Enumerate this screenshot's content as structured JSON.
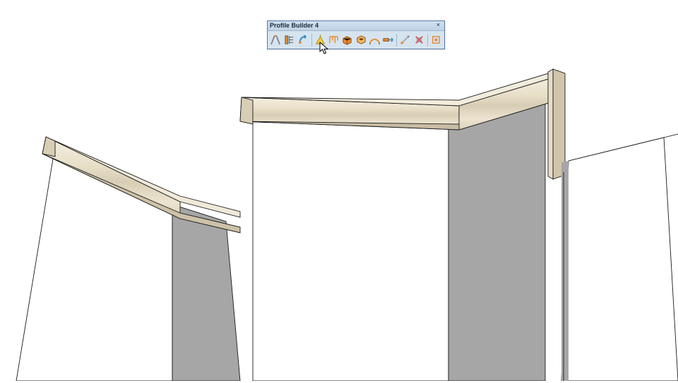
{
  "toolbar": {
    "title": "Profile Builder 4",
    "close": "×",
    "buttons": [
      {
        "name": "profile-builder-icon",
        "title": "Profile Builder"
      },
      {
        "name": "build-profile-icon",
        "title": "Build"
      },
      {
        "name": "revolve-icon",
        "title": "Build Along Path"
      },
      {
        "name": "trim-icon",
        "title": "Trim"
      },
      {
        "name": "smart-path-icon",
        "title": "Smart Path Select"
      },
      {
        "name": "assembly-icon",
        "title": "Assembler"
      },
      {
        "name": "hole-icon",
        "title": "Hole Tool"
      },
      {
        "name": "span-icon",
        "title": "Span Tool"
      },
      {
        "name": "extend-icon",
        "title": "Extend"
      },
      {
        "name": "slice-icon",
        "title": "Slice"
      },
      {
        "name": "remove-icon",
        "title": "Remove Holes"
      },
      {
        "name": "quantify-icon",
        "title": "Quantifier"
      }
    ]
  }
}
